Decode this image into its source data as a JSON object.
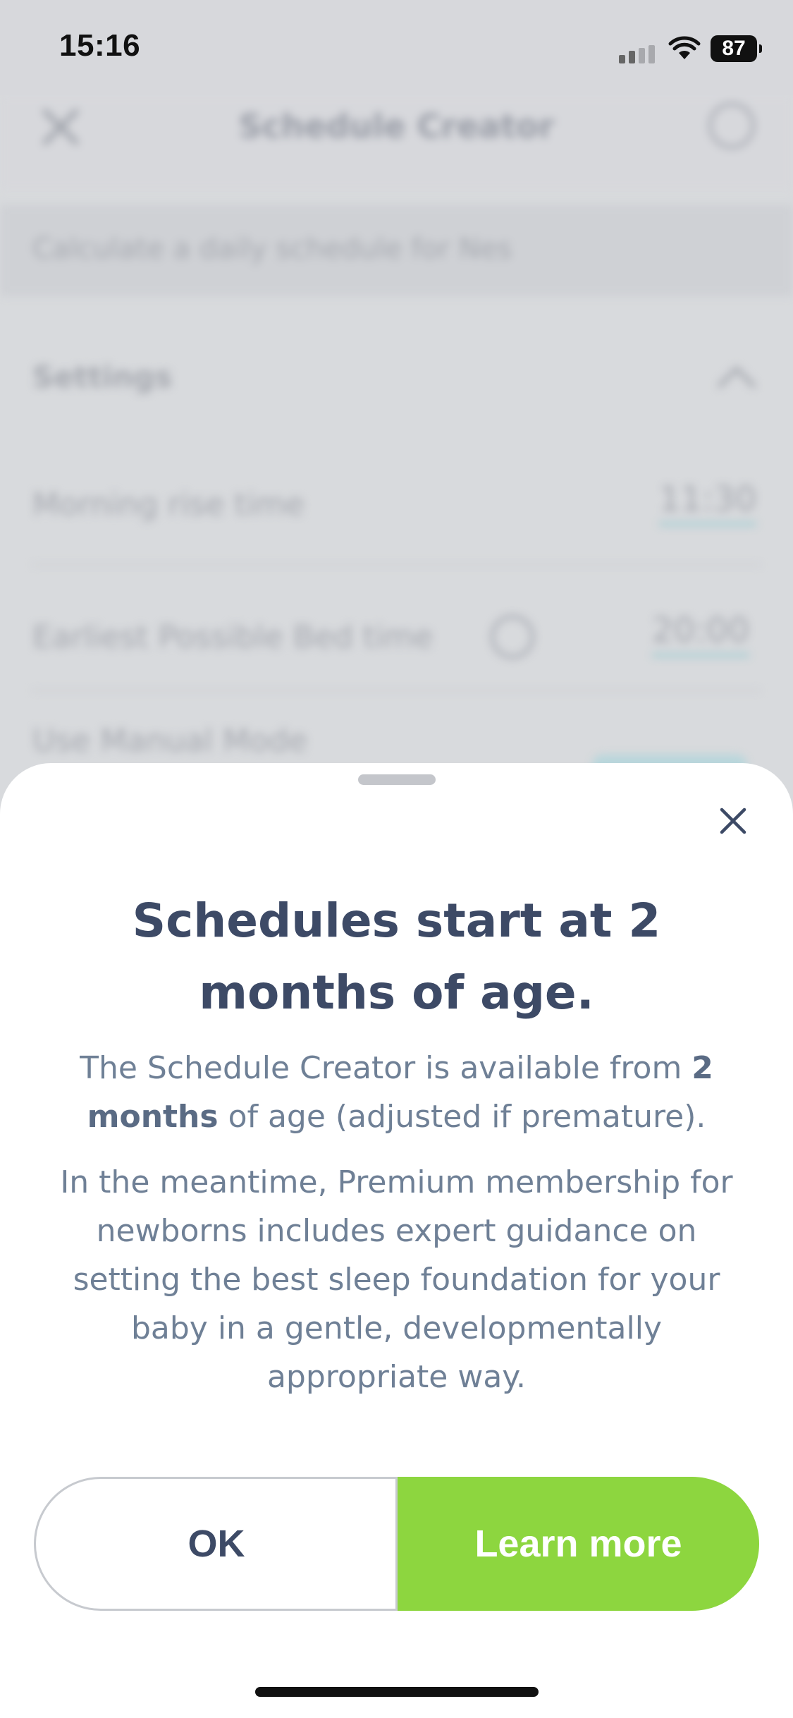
{
  "status_bar": {
    "time": "15:16",
    "battery": "87"
  },
  "background": {
    "nav_title": "Schedule Creator",
    "subtitle": "Calculate a daily schedule for Nes",
    "settings_label": "Settings",
    "settings": [
      {
        "label": "Morning rise time",
        "value": "11:30"
      },
      {
        "label": "Earliest Possible Bed time",
        "value": "20:00"
      },
      {
        "label": "Use Manual Mode",
        "value": ""
      }
    ]
  },
  "sheet": {
    "title": "Schedules start at 2 months of age.",
    "p1_a": "The Schedule Creator is available from ",
    "p1_bold": "2 months",
    "p1_b": " of age (adjusted if premature).",
    "p2": "In the meantime, Premium membership for newborns includes expert guidance on setting the best sleep foundation for your baby in a gentle, developmentally appropriate way.",
    "ok_label": "OK",
    "learn_more_label": "Learn more"
  },
  "colors": {
    "accent_green": "#8dd63f",
    "title_text": "#3d4a66",
    "body_text": "#6f8096"
  }
}
